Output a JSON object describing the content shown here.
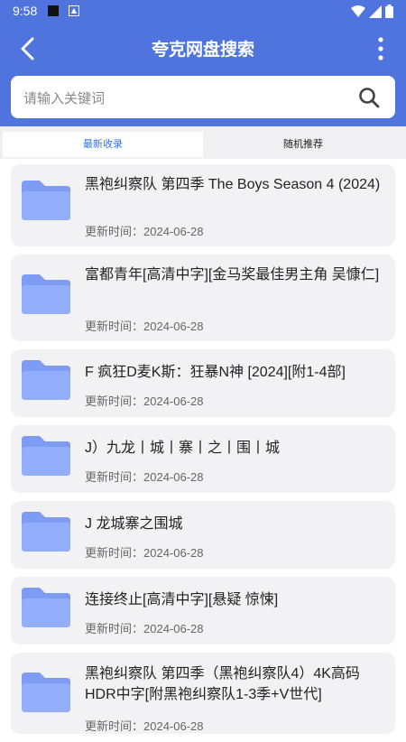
{
  "status_bar": {
    "time": "9:58"
  },
  "header": {
    "title": "夸克网盘搜索"
  },
  "search": {
    "placeholder": "请输入关键词"
  },
  "tabs": [
    {
      "label": "最新收录",
      "active": true
    },
    {
      "label": "随机推荐",
      "active": false
    }
  ],
  "items": [
    {
      "title": "黑袍纠察队 第四季 The Boys Season 4 (2024)",
      "date_label": "更新时间：",
      "date": "2024-06-28"
    },
    {
      "title": "富都青年[高清中字][金马奖最佳男主角 吴慷仁]",
      "date_label": "更新时间：",
      "date": "2024-06-28"
    },
    {
      "title": "F 疯狂D麦K斯：狂暴N神 [2024][附1-4部]",
      "date_label": "更新时间：",
      "date": "2024-06-28"
    },
    {
      "title": "J）九龙丨城丨寨丨之丨围丨城",
      "date_label": "更新时间：",
      "date": "2024-06-28"
    },
    {
      "title": "J 龙城寨之围城",
      "date_label": "更新时间：",
      "date": "2024-06-28"
    },
    {
      "title": "连接终止[高清中字][悬疑 惊悚]",
      "date_label": "更新时间：",
      "date": "2024-06-28"
    },
    {
      "title": "黑袍纠察队 第四季（黑袍纠察队4）4K高码HDR中字[附黑袍纠察队1-3季+V世代]",
      "date_label": "更新时间：",
      "date": "2024-06-28"
    }
  ],
  "colors": {
    "header": "#4f74dd",
    "tab_active_text": "#2f73e8",
    "card_bg": "#f2f2f4",
    "folder": "#7f9cf5"
  },
  "icons": {
    "back": "back-arrow-icon",
    "more": "more-vertical-icon",
    "search": "search-icon",
    "folder": "folder-icon"
  }
}
